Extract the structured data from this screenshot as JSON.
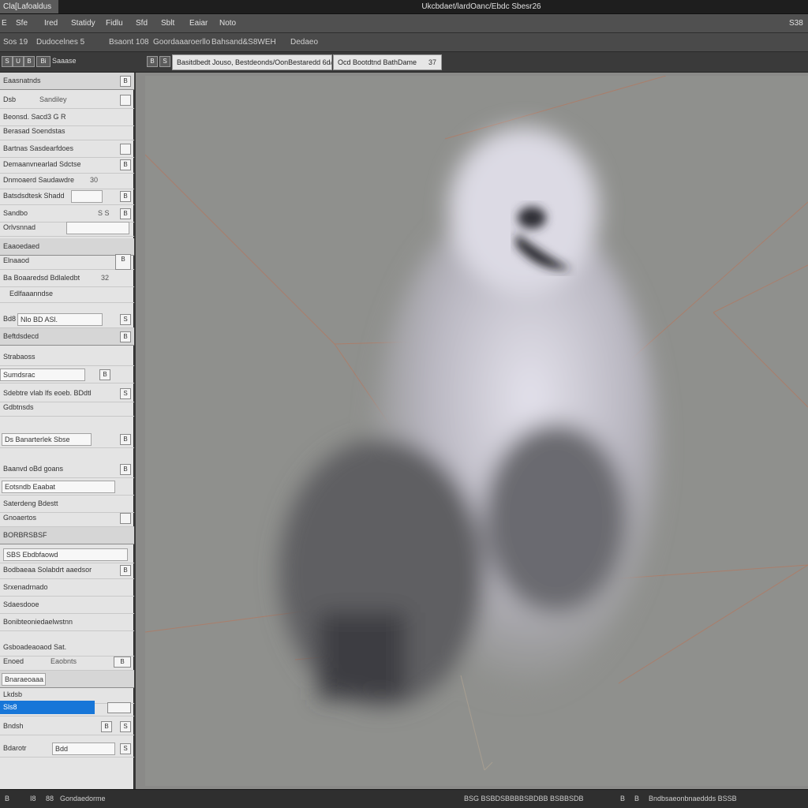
{
  "titlebar": {
    "app_tab": "Cla[Lafoaldus",
    "window_title": "Ukcbdaet/lardOanc/Ebdc Sbesr26"
  },
  "menubar": {
    "items": [
      "E",
      "Sfe",
      "Ired",
      "Statidy",
      "Fidlu",
      "Sfd",
      "Sblt",
      "Eaiar",
      "Noto"
    ],
    "right_label": "S38"
  },
  "optionsbar": {
    "items": [
      "Sos 19",
      "Dudocelnes 5",
      "Bsaont 108",
      "Goordaaaroerllo",
      "Bahsand&S8WEH",
      "Dedaeo"
    ]
  },
  "docbar": {
    "mini_icons": [
      "S",
      "U",
      "B",
      "Bi"
    ],
    "panel_title": "Saaase",
    "small_icons": [
      "B",
      "S"
    ],
    "tab1": "Basitdbedt Jouso, Bestdeonds/OonBestaredd 6d/ 08",
    "tab2": "Ocd Bootdtnd BathDame",
    "tab2_close": "37"
  },
  "leftpanel": {
    "rows": [
      {
        "label": "Eaasnatnds",
        "value": "",
        "box": "B"
      },
      {
        "label": "Dsb",
        "value": "Sandiley",
        "box": ""
      },
      {
        "label": "Beonsd. Sacd3 G   R",
        "value": "",
        "box": ""
      },
      {
        "label": "Berasad Soendstas",
        "value": "",
        "box": ""
      },
      {
        "label": "Bartnas Sasdearfdoes",
        "value": "",
        "box": ""
      },
      {
        "label": "Demaanvnearlad Sdctse",
        "value": "",
        "box": "B"
      },
      {
        "label": "Dnmoaerd Saudawdre",
        "value": "30",
        "box": ""
      },
      {
        "label": "Batsdsdtesk Shadd",
        "value": "",
        "box": "B"
      },
      {
        "label": "Sandbo",
        "value": "S S",
        "box": "B"
      },
      {
        "label": "Orlvsnnad",
        "value": "",
        "box": ""
      },
      {
        "label": "Eaaoedaed",
        "value": "",
        "box": ""
      },
      {
        "label": "Elnaaod",
        "value": "",
        "box": "B"
      },
      {
        "label": "Ba Boaaredsd Bdlaledbt",
        "value": "32",
        "box": ""
      },
      {
        "label": "Edlfaaanndse",
        "value": "",
        "box": ""
      },
      {
        "label": "Bd8",
        "value": "Nlo BD  ASl.",
        "box": "S"
      },
      {
        "label": "Beftdsdecd",
        "value": "",
        "box": "B"
      },
      {
        "label": "Strabaoss",
        "value": "",
        "box": ""
      },
      {
        "label": "Sumdsrac",
        "value": "",
        "box": "B"
      },
      {
        "label": "Sdebtre vlab lfs eoeb. BDdtl",
        "value": "",
        "box": "S"
      },
      {
        "label": "Gdbtnsds",
        "value": "",
        "box": ""
      },
      {
        "label": "Ds Banarterlek Sbse",
        "value": "",
        "box": "B"
      },
      {
        "label": "Baanvd oBd   goans",
        "value": "",
        "box": "B"
      },
      {
        "label": "Eotsndb   Eaabat",
        "value": "",
        "box": ""
      },
      {
        "label": "Saterdeng Bdestt",
        "value": "",
        "box": "B"
      },
      {
        "label": "Gnoaertos",
        "value": "",
        "box": ""
      },
      {
        "label": "BORBRSBSF",
        "value": "",
        "box": "S"
      },
      {
        "label": "SBS Ebdbfaowd",
        "value": "",
        "box": "S"
      },
      {
        "label": "Bodbaeaa Solabdrt aaedsor",
        "value": "",
        "box": "B"
      },
      {
        "label": "Srxenadrnado",
        "value": "",
        "box": ""
      },
      {
        "label": "Sdaesdooe",
        "value": "",
        "box": ""
      },
      {
        "label": "Bonibteoniedaelwstnn",
        "value": "",
        "box": ""
      },
      {
        "label": "Gsboadeaoaod Sat.",
        "value": "",
        "box": ""
      },
      {
        "label": "Enoed",
        "value": "Eaobnts",
        "box": "B"
      },
      {
        "label": "Bnaraeoaaa",
        "value": "",
        "box": ""
      },
      {
        "label": "Lkdsb",
        "value": "",
        "box": ""
      },
      {
        "label": "S3d",
        "value": "",
        "box": "B"
      },
      {
        "label": "Bndsh",
        "value": "",
        "box": "S"
      },
      {
        "label": "Bdarotr",
        "value": "Bdd",
        "box": "S"
      }
    ],
    "selected_label": "Sls8"
  },
  "statusbar": {
    "left": [
      "B",
      "I8",
      "88",
      "Gondaedorme"
    ],
    "middle": "BSG BSBDSBBBBSBDBB BSBBSDB",
    "right": [
      "B",
      "B",
      "Bndbsaeonbnaeddds BSSB"
    ]
  }
}
